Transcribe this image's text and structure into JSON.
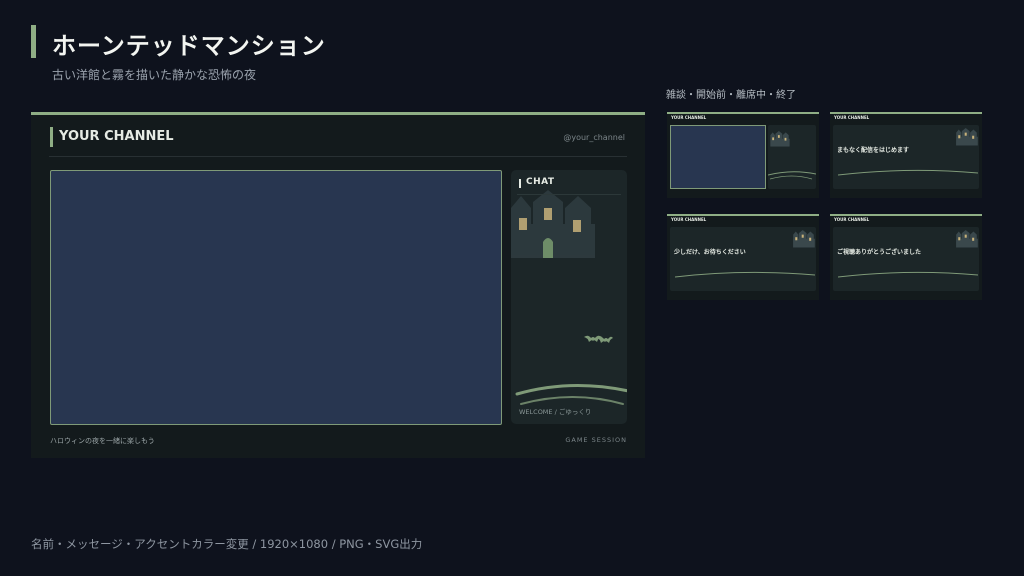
{
  "header": {
    "title": "ホーンテッドマンション",
    "subtitle": "古い洋館と霧を描いた静かな恐怖の夜"
  },
  "main_preview": {
    "channel_name": "YOUR CHANNEL",
    "handle": "@your_channel",
    "chat_label": "CHAT",
    "welcome": "WELCOME / ごゆっくり",
    "tagline": "ハロウィンの夜を一緒に楽しもう",
    "session": "GAME SESSION"
  },
  "thumbnails": {
    "label": "雑談・開始前・離席中・終了",
    "items": [
      {
        "channel": "YOUR CHANNEL",
        "headline": ""
      },
      {
        "channel": "YOUR CHANNEL",
        "headline": "まもなく配信をはじめます"
      },
      {
        "channel": "YOUR CHANNEL",
        "headline": "少しだけ、お待ちください"
      },
      {
        "channel": "YOUR CHANNEL",
        "headline": "ご視聴ありがとうございました"
      }
    ]
  },
  "footer": {
    "note": "名前・メッセージ・アクセントカラー変更 / 1920×1080 / PNG・SVG出力"
  },
  "colors": {
    "background": "#0e121d",
    "accent": "#8fae85",
    "frame_fill": "#283650",
    "panel": "#1c2628",
    "window_glow": "#c8b27a"
  },
  "icons": [
    "mansion-icon",
    "bats-icon",
    "hills-icon"
  ]
}
